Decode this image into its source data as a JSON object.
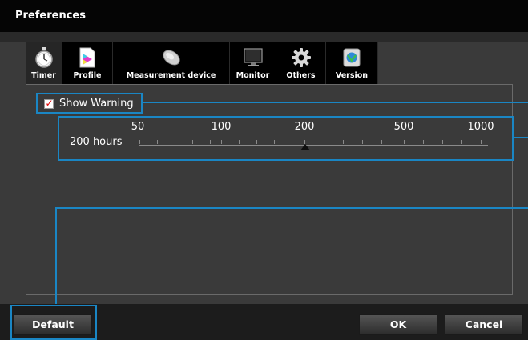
{
  "window": {
    "title": "Preferences"
  },
  "tabs": [
    {
      "label": "Timer",
      "icon": "stopwatch-icon",
      "active": true
    },
    {
      "label": "Profile",
      "icon": "color-profile-icon",
      "active": false
    },
    {
      "label": "Measurement device",
      "icon": "calibration-sensor-icon",
      "active": false
    },
    {
      "label": "Monitor",
      "icon": "monitor-icon",
      "active": false
    },
    {
      "label": "Others",
      "icon": "gear-icon",
      "active": false
    },
    {
      "label": "Version",
      "icon": "version-icon",
      "active": false
    }
  ],
  "timer": {
    "show_warning_label": "Show Warning",
    "show_warning_checked": true,
    "hours_value": "200 hours",
    "scale_labels": [
      "50",
      "100",
      "200",
      "500",
      "1000"
    ],
    "selected_value": 200
  },
  "buttons": {
    "default": "Default",
    "ok": "OK",
    "cancel": "Cancel"
  },
  "colors": {
    "callout": "#1a86c4",
    "check": "#e00000"
  }
}
